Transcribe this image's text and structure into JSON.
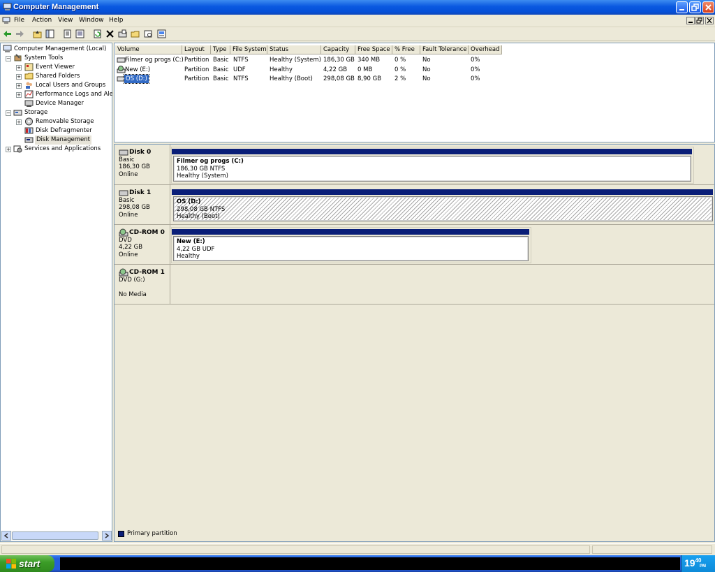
{
  "window": {
    "title": "Computer Management"
  },
  "menu": {
    "items": [
      "File",
      "Action",
      "View",
      "Window",
      "Help"
    ]
  },
  "toolbar": {
    "icons": [
      "back-icon",
      "forward-icon",
      "up-level-icon",
      "show-hide-tree-icon",
      "properties-icon",
      "show-hide-icon",
      "refresh-icon",
      "delete-icon",
      "disk-properties-icon",
      "open-icon",
      "search-icon",
      "help-icon"
    ]
  },
  "tree": {
    "root": "Computer Management (Local)",
    "system_tools": "System Tools",
    "event_viewer": "Event Viewer",
    "shared_folders": "Shared Folders",
    "local_users": "Local Users and Groups",
    "perf_logs": "Performance Logs and Alerts",
    "device_manager": "Device Manager",
    "storage": "Storage",
    "removable_storage": "Removable Storage",
    "disk_defrag": "Disk Defragmenter",
    "disk_management": "Disk Management",
    "services": "Services and Applications"
  },
  "volumes": {
    "headers": [
      "Volume",
      "Layout",
      "Type",
      "File System",
      "Status",
      "Capacity",
      "Free Space",
      "% Free",
      "Fault Tolerance",
      "Overhead"
    ],
    "rows": [
      [
        "Filmer og progs (C:)",
        "Partition",
        "Basic",
        "NTFS",
        "Healthy (System)",
        "186,30 GB",
        "340 MB",
        "0 %",
        "No",
        "0%"
      ],
      [
        "New (E:)",
        "Partition",
        "Basic",
        "UDF",
        "Healthy",
        "4,22 GB",
        "0 MB",
        "0 %",
        "No",
        "0%"
      ],
      [
        "OS (D:)",
        "Partition",
        "Basic",
        "NTFS",
        "Healthy (Boot)",
        "298,08 GB",
        "8,90 GB",
        "2 %",
        "No",
        "0%"
      ]
    ]
  },
  "disks": [
    {
      "name": "Disk 0",
      "type": "Basic",
      "size": "186,30 GB",
      "state": "Online",
      "part_title": "Filmer og progs  (C:)",
      "part_size": "186,30 GB NTFS",
      "part_status": "Healthy (System)"
    },
    {
      "name": "Disk 1",
      "type": "Basic",
      "size": "298,08 GB",
      "state": "Online",
      "part_title": "OS  (D:)",
      "part_size": "298,08 GB NTFS",
      "part_status": "Healthy (Boot)"
    },
    {
      "name": "CD-ROM 0",
      "type": "DVD",
      "size": "4,22 GB",
      "state": "Online",
      "part_title": "New  (E:)",
      "part_size": "4,22 GB UDF",
      "part_status": "Healthy"
    },
    {
      "name": "CD-ROM 1",
      "type": "DVD (G:)",
      "size": "",
      "state": "No Media"
    }
  ],
  "legend": {
    "primary": "Primary partition"
  },
  "taskbar": {
    "start": "start",
    "clock_hour": "19",
    "clock_min": "40",
    "clock_ampm": "PM"
  },
  "colors": {
    "partition_bar": "#0a1e78",
    "titlebar": "#0a58e0"
  }
}
